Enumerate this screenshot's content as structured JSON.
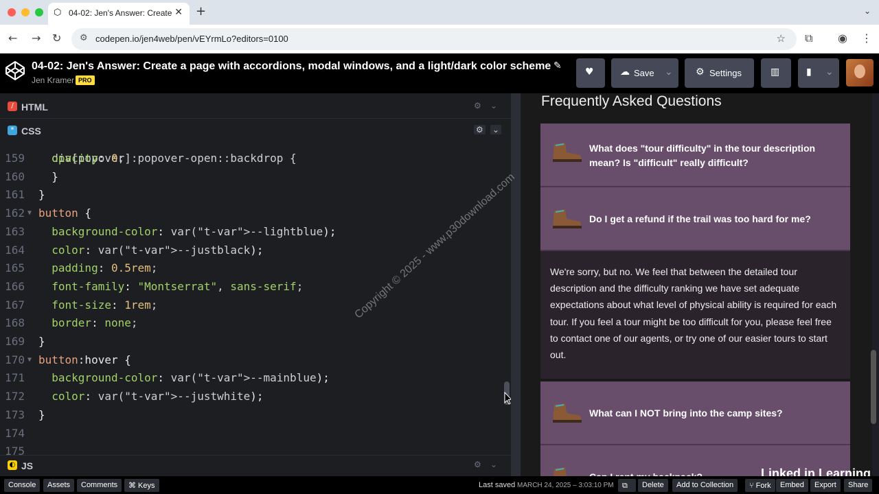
{
  "browser": {
    "tab_title": "04-02: Jen's Answer: Create",
    "tab_close": "✕",
    "new_tab": "+",
    "url": "codepen.io/jen4web/pen/vEYrmLo?editors=0100"
  },
  "header": {
    "pen_title": "04-02: Jen's Answer: Create a page with accordions, modal windows, and a light/dark color scheme",
    "author": "Jen Kramer",
    "pro_badge": "PRO",
    "save_label": "Save",
    "settings_label": "Settings"
  },
  "panes": {
    "html_label": "HTML",
    "css_label": "CSS",
    "js_label": "JS"
  },
  "code": {
    "partial_top": "  div[popover]:popover-open::backdrop {",
    "lines": [
      {
        "n": "159",
        "text": "  opacity: 0;"
      },
      {
        "n": "160",
        "text": "  }"
      },
      {
        "n": "161",
        "text": "}"
      },
      {
        "n": "162",
        "text": "button {"
      },
      {
        "n": "163",
        "text": "  background-color: var(--lightblue);"
      },
      {
        "n": "164",
        "text": "  color: var(--justblack);"
      },
      {
        "n": "165",
        "text": "  padding: 0.5rem;"
      },
      {
        "n": "166",
        "text": "  font-family: \"Montserrat\", sans-serif;"
      },
      {
        "n": "167",
        "text": "  font-size: 1rem;"
      },
      {
        "n": "168",
        "text": "  border: none;"
      },
      {
        "n": "169",
        "text": "}"
      },
      {
        "n": "170",
        "text": "button:hover {"
      },
      {
        "n": "171",
        "text": "  background-color: var(--mainblue);"
      },
      {
        "n": "172",
        "text": "  color: var(--justwhite);"
      },
      {
        "n": "173",
        "text": "}"
      },
      {
        "n": "174",
        "text": ""
      },
      {
        "n": "175",
        "text": ""
      }
    ]
  },
  "preview": {
    "heading": "Frequently Asked Questions",
    "questions": [
      "What does \"tour difficulty\" in the tour description mean? Is \"difficult\" really difficult?",
      "Do I get a refund if the trail was too hard for me?",
      "What can I NOT bring into the camp sites?",
      "Can I rent my backpack?"
    ],
    "answer": "We're sorry, but no. We feel that between the detailed tour description and the difficulty ranking we have set adequate expectations about what level of physical ability is required for each tour. If you feel a tour might be too difficult for you, please feel free to contact one of our agents, or try one of our easier tours to start out."
  },
  "overlays": {
    "watermark": "Copyright © 2025 - www.p30download.com",
    "brand": "Linked in Learning"
  },
  "footer": {
    "console": "Console",
    "assets": "Assets",
    "comments": "Comments",
    "keys": "⌘ Keys",
    "saved_prefix": "Last saved",
    "saved_date": "MARCH 24, 2025 – 3:03:10 PM",
    "delete": "Delete",
    "add_collection": "Add to Collection",
    "fork": "Fork",
    "embed": "Embed",
    "export": "Export",
    "share": "Share"
  },
  "colors": {
    "accordion_bg": "#694e6c",
    "answer_bg": "#2b232c",
    "pro_badge": "#ffdd40"
  }
}
